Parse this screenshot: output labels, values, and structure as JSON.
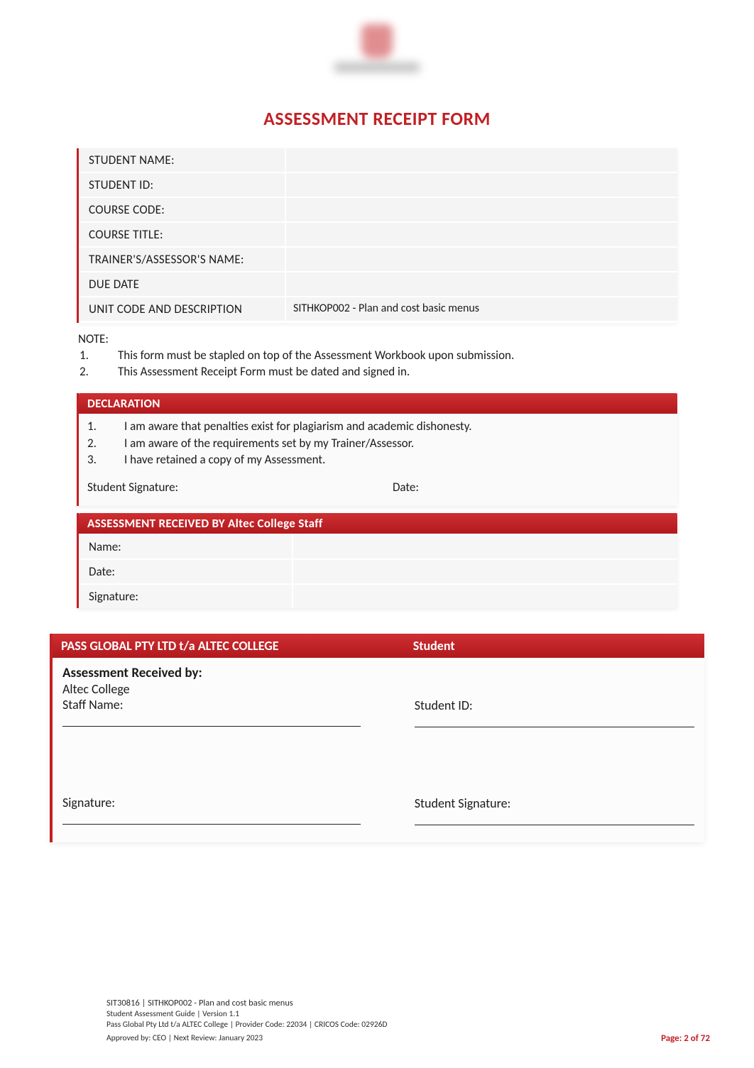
{
  "title_main": "ASSESSMENT RECEIPT",
  "title_form": "FORM",
  "info_rows": [
    {
      "label": "STUDENT NAME:",
      "value": ""
    },
    {
      "label": "STUDENT ID:",
      "value": ""
    },
    {
      "label": "COURSE CODE:",
      "value": ""
    },
    {
      "label": "COURSE TITLE:",
      "value": ""
    },
    {
      "label": "TRAINER'S/ASSESSOR'S NAME:",
      "value": ""
    },
    {
      "label": "DUE DATE",
      "value": ""
    },
    {
      "label": "UNIT CODE AND DESCRIPTION",
      "value": "SITHKOP002 - Plan and cost basic menus"
    }
  ],
  "note_head": "NOTE:",
  "notes": [
    "This form must be stapled on top of the Assessment Workbook upon submission.",
    "This Assessment Receipt Form must be dated and signed in."
  ],
  "declaration_header": "DECLARATION",
  "declaration_items": [
    "I am aware that penalties exist for plagiarism and academic dishonesty.",
    "I am aware of the requirements set by my Trainer/Assessor.",
    "I have retained a copy of my Assessment."
  ],
  "student_signature_label": "Student Signature:",
  "date_label": "Date:",
  "received_header": "ASSESSMENT RECEIVED BY Altec College Staff",
  "received_rows": [
    {
      "label": "Name:",
      "value": ""
    },
    {
      "label": "Date:",
      "value": ""
    },
    {
      "label": "Signature:",
      "value": ""
    }
  ],
  "bottom_left_header": "PASS GLOBAL PTY LTD t/a ALTEC COLLEGE",
  "bottom_right_header": "Student",
  "bottom_left": {
    "received_by": "Assessment Received by:",
    "org_line": "Altec College",
    "staff_name_label": "Staff Name:",
    "signature_label": "Signature:"
  },
  "bottom_right": {
    "student_id_label": "Student ID:",
    "student_signature_label": "Student Signature:"
  },
  "footer": {
    "line1": "SIT30816 | SITHKOP002 - Plan and cost basic menus",
    "line2": "Student Assessment Guide  | Version 1.1",
    "line3": "Pass Global Pty Ltd t/a ALTEC College  | Provider Code: 22034 | CRICOS Code: 02926D",
    "line4": "Approved by: CEO  | Next Review: January 2023",
    "page": "Page: 2 of 72"
  }
}
